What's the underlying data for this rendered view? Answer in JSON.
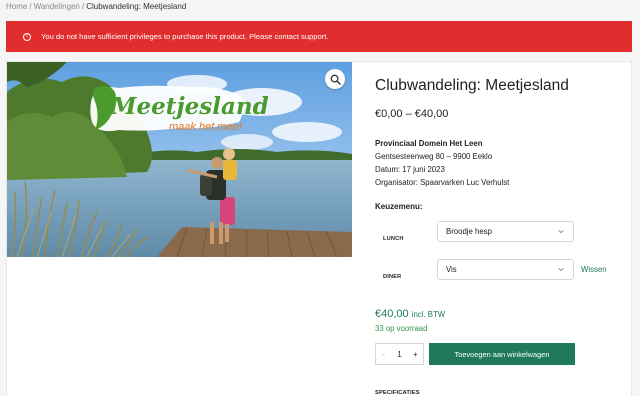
{
  "breadcrumb": {
    "home": "Home",
    "category": "Wandelingen",
    "current": "Clubwandeling: Meetjesland",
    "separator": "/"
  },
  "alert": {
    "message": "You do not have sufficient privileges to purchase this product. Please contact support.",
    "icon": "info-circle-icon"
  },
  "image": {
    "logo_main": "Meetjesland",
    "logo_tagline": "maak het mee!"
  },
  "product": {
    "title": "Clubwandeling: Meetjesland",
    "price_range": "€0,00 – €40,00",
    "venue": "Provinciaal Domein Het Leen",
    "address": "Gentsesteenweg 80 – 9900 Eeklo",
    "date": "Datum: 17 juni 2023",
    "organizer": "Organisator: Spaarvarken Luc Verhulst",
    "menu_label": "Keuzemenu:",
    "variations": [
      {
        "label": "LUNCH",
        "value": "Broodje hesp"
      },
      {
        "label": "DINER",
        "value": "Vis"
      }
    ],
    "clear_label": "Wissen",
    "price": "€40,00",
    "price_suffix": "incl. BTW",
    "stock": "33 op voorraad",
    "quantity": {
      "minus": "-",
      "value": "1",
      "plus": "+"
    },
    "add_to_cart": "Toevoegen aan winkelwagen",
    "specs_heading": "SPECIFICATIES"
  },
  "colors": {
    "alert": "#e12d2d",
    "accent": "#1e7a5a",
    "stock": "#2e9a4f",
    "logo_green": "#4a9a2e",
    "logo_orange": "#e8791e"
  }
}
